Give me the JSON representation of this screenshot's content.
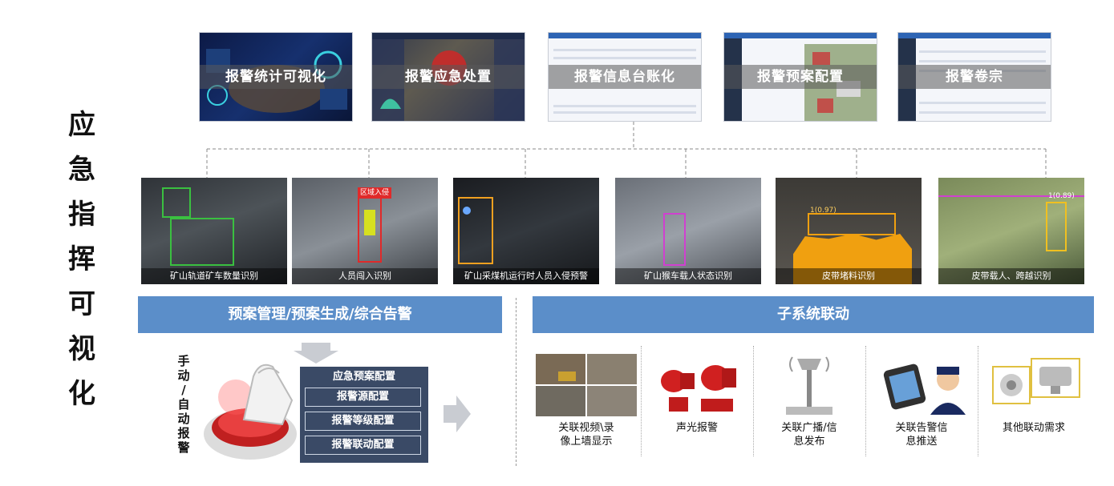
{
  "title_chars": [
    "应",
    "急",
    "指",
    "挥",
    "可",
    "视",
    "化"
  ],
  "screens": [
    {
      "label": "报警统计可视化",
      "style": "dark1"
    },
    {
      "label": "报警应急处置",
      "style": "dark2"
    },
    {
      "label": "报警信息台账化",
      "style": "light"
    },
    {
      "label": "报警预案配置",
      "style": "light"
    },
    {
      "label": "报警卷宗",
      "style": "light"
    }
  ],
  "cameras": [
    {
      "caption": "矿山轨道矿车数量识别"
    },
    {
      "caption": "人员闯入识别",
      "tag": "区域入侵"
    },
    {
      "caption": "矿山采煤机运行时人员入侵预警"
    },
    {
      "caption": "矿山猴车载人状态识别"
    },
    {
      "caption": "皮带堵料识别",
      "tag": "1(0.97)"
    },
    {
      "caption": "皮带载人、跨越识别",
      "tag": "1(0.89)"
    }
  ],
  "left_section": {
    "header": "预案管理/预案生成/综合告警",
    "manual_chars": [
      "手",
      "动",
      "/",
      "自",
      "动",
      "报",
      "警"
    ],
    "config_title": "应急预案配置",
    "config_items": [
      "报警源配置",
      "报警等级配置",
      "报警联动配置"
    ]
  },
  "right_section": {
    "header": "子系统联动",
    "items": [
      {
        "label_line1": "关联视频\\录",
        "label_line2": "像上墙显示",
        "icon": "video-wall-icon"
      },
      {
        "label_line1": "声光报警",
        "label_line2": "",
        "icon": "siren-icon"
      },
      {
        "label_line1": "关联广播/信",
        "label_line2": "息发布",
        "icon": "broadcast-tower-icon"
      },
      {
        "label_line1": "关联告警信",
        "label_line2": "息推送",
        "icon": "phone-guard-icon"
      },
      {
        "label_line1": "其他联动需求",
        "label_line2": "",
        "icon": "speaker-camera-icon"
      }
    ]
  },
  "colors": {
    "header_blue": "#5b8ec9",
    "config_bg": "#3a4a66"
  }
}
